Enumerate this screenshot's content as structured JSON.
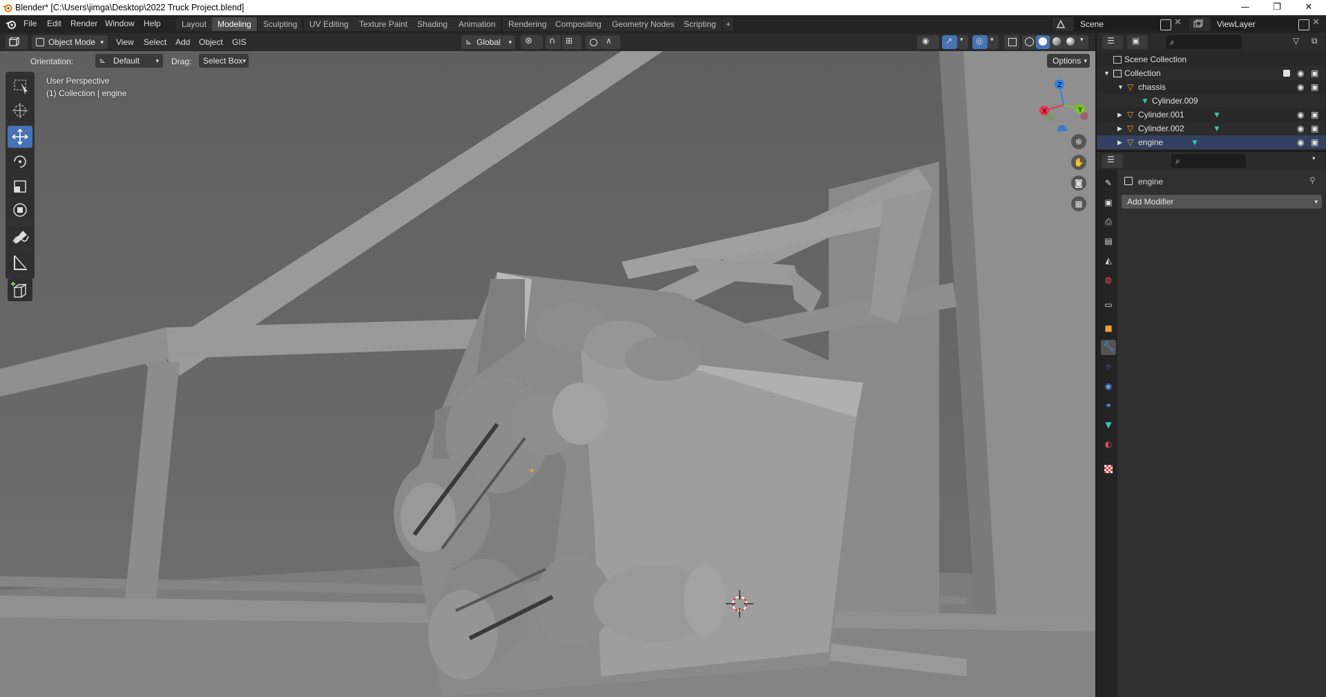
{
  "window": {
    "title": "Blender* [C:\\Users\\jimga\\Desktop\\2022 Truck Project.blend]",
    "minimize": "—",
    "maximize": "❐",
    "close": "✕"
  },
  "menubar": {
    "items": [
      "File",
      "Edit",
      "Render",
      "Window",
      "Help"
    ]
  },
  "workspaces": {
    "tabs": [
      "Layout",
      "Modeling",
      "Sculpting",
      "UV Editing",
      "Texture Paint",
      "Shading",
      "Animation",
      "Rendering",
      "Compositing",
      "Geometry Nodes",
      "Scripting"
    ],
    "active": "Modeling",
    "add": "+"
  },
  "scene": {
    "name": "Scene",
    "viewlayer": "ViewLayer"
  },
  "viewport_header": {
    "mode": "Object Mode",
    "menus": [
      "View",
      "Select",
      "Add",
      "Object",
      "GIS"
    ],
    "transform_orientation": "Global"
  },
  "tool_settings": {
    "orientation_label": "Orientation:",
    "orientation_value": "Default",
    "drag_label": "Drag:",
    "drag_value": "Select Box",
    "options": "Options"
  },
  "viewport": {
    "perspective": "User Perspective",
    "context": "(1) Collection | engine",
    "gizmo": {
      "x": "X",
      "y": "Y",
      "z": "Z"
    }
  },
  "outliner": {
    "rows": [
      {
        "label": "Scene Collection"
      },
      {
        "label": "Collection"
      },
      {
        "label": "chassis"
      },
      {
        "label": "Cylinder.009"
      },
      {
        "label": "Cylinder.001"
      },
      {
        "label": "Cylinder.002"
      },
      {
        "label": "engine"
      }
    ]
  },
  "properties": {
    "object_name": "engine",
    "add_modifier": "Add Modifier"
  },
  "colors": {
    "accent": "#4772b3",
    "axis_x": "#e8364e",
    "axis_y": "#7ac624",
    "axis_z": "#2f84e3",
    "object_orange": "#e8a03a",
    "mesh_green": "#38c8a8"
  }
}
